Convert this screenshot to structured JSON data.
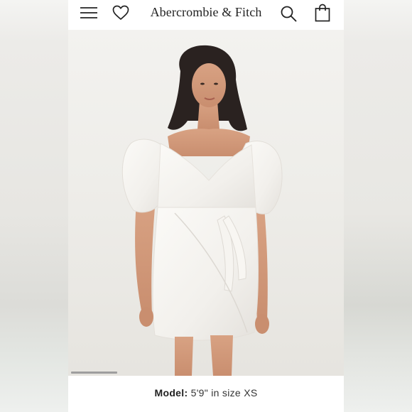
{
  "header": {
    "brand": "Abercrombie & Fitch",
    "icons": {
      "menu": "hamburger-menu-icon",
      "favorites": "heart-icon",
      "search": "search-icon",
      "bag": "shopping-bag-icon"
    }
  },
  "product_image": {
    "description_role": "product-photo",
    "carousel_progress": 0.17
  },
  "caption": {
    "label": "Model:",
    "value": "5'9\" in size XS"
  },
  "colors": {
    "header_bg": "#ffffff",
    "photo_bg": "#eeede9",
    "text": "#333333"
  }
}
